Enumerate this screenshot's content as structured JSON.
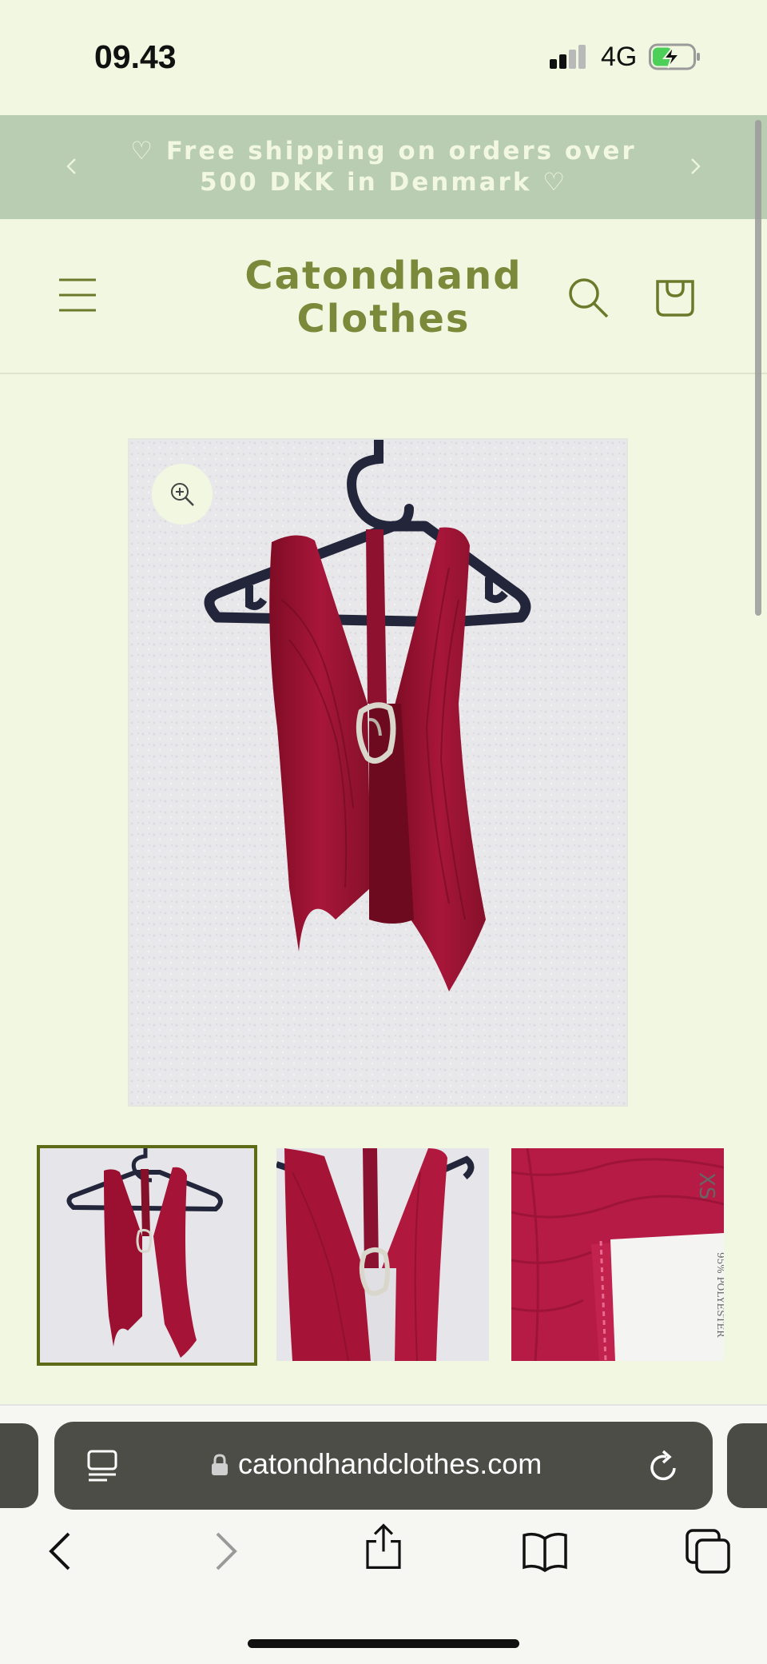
{
  "status_bar": {
    "time": "09.43",
    "network": "4G",
    "battery_icon": "battery-charging-icon",
    "signal_icon": "signal-bars-icon"
  },
  "announcement": {
    "text": "♡ Free shipping on orders over 500 DKK in Denmark ♡",
    "prev_icon": "chevron-left-icon",
    "next_icon": "chevron-right-icon"
  },
  "header": {
    "logo": "Catondhand Clothes",
    "menu_icon": "hamburger-menu-icon",
    "search_icon": "search-icon",
    "cart_icon": "cart-bag-icon"
  },
  "product_gallery": {
    "zoom_icon": "zoom-in-icon",
    "thumbnail_count": 3,
    "selected_thumbnail": 1,
    "label_on_garment_tag": "XS",
    "label_on_garment_tag_sub": "95% POLYESTER"
  },
  "browser": {
    "url": "catondhandclothes.com",
    "icons": [
      "reader-mode-icon",
      "lock-icon",
      "reload-icon",
      "back-icon",
      "forward-icon",
      "share-icon",
      "bookmarks-icon",
      "tabs-icon"
    ]
  },
  "colors": {
    "page_bg": "#f2f7e1",
    "announcement_bg": "#b8cdb1",
    "brand_green": "#7b8a3a",
    "selected_border": "#5d6a16",
    "garment_red": "#9b1030"
  }
}
